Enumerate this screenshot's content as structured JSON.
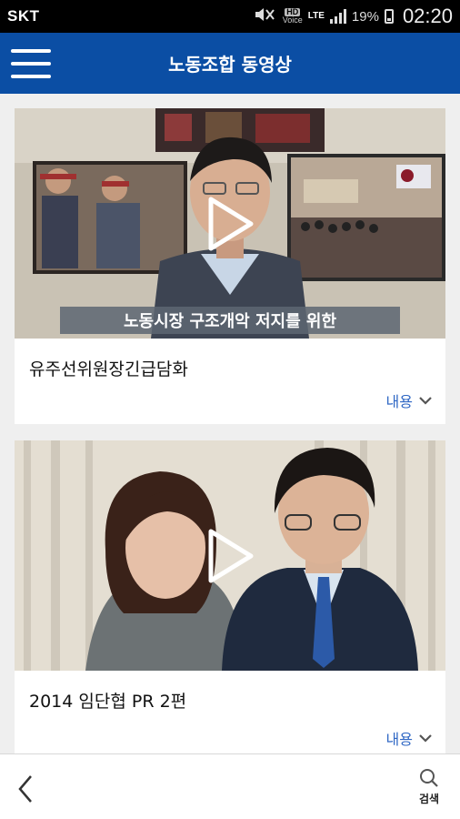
{
  "status_bar": {
    "carrier": "SKT",
    "hd_label": "HD",
    "voice_label": "Voice",
    "network": "LTE",
    "battery": "19%",
    "time": "02:20"
  },
  "app_bar": {
    "title": "노동조합 동영상",
    "menu_icon": "hamburger-icon"
  },
  "videos": [
    {
      "title": "유주선위원장긴급담화",
      "subtitle_caption": "노동시장 구조개악 저지를 위한",
      "more_label": "내용"
    },
    {
      "title": "2014 임단협 PR 2편",
      "more_label": "내용"
    }
  ],
  "bottom_bar": {
    "back_icon": "chevron-left-icon",
    "search_label": "검색",
    "search_icon": "search-icon"
  },
  "colors": {
    "app_bar": "#0b4ea4",
    "link": "#2f67c4",
    "background": "#efefef"
  }
}
